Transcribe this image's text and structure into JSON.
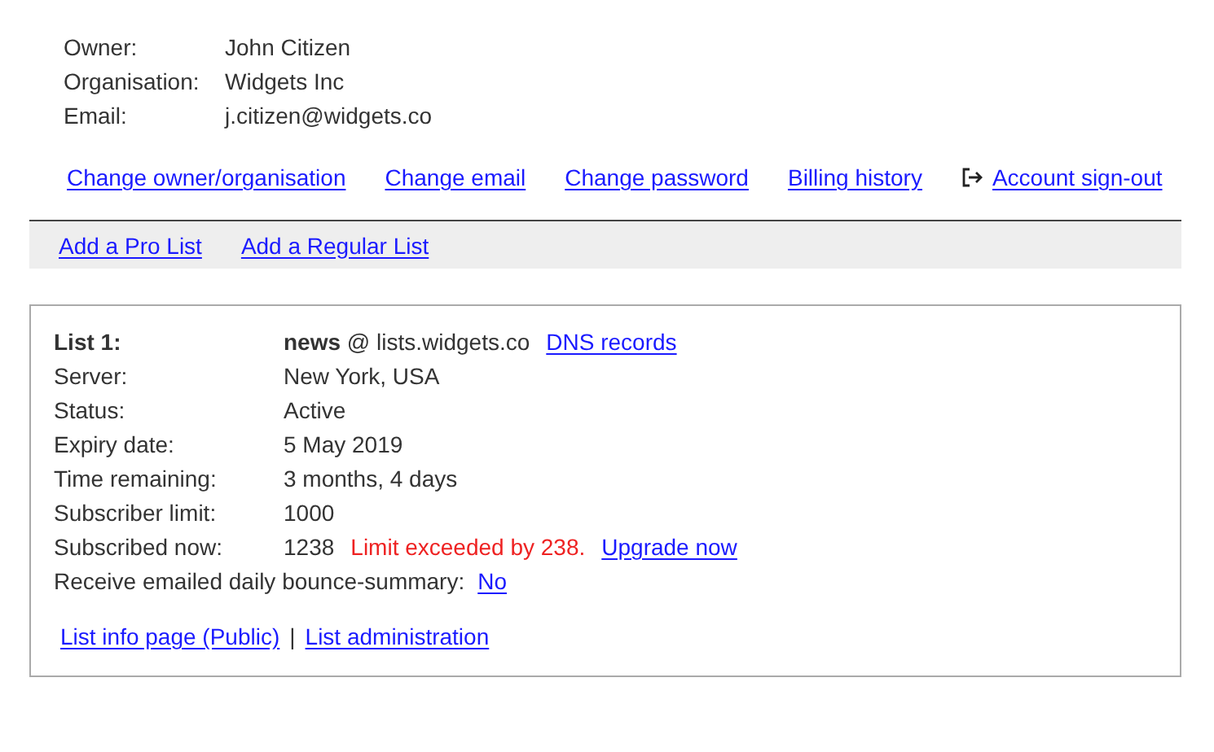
{
  "account": {
    "fields": [
      {
        "label": "Owner:",
        "value": "John Citizen"
      },
      {
        "label": "Organisation:",
        "value": "Widgets Inc"
      },
      {
        "label": "Email:",
        "value": "j.citizen@widgets.co"
      }
    ],
    "links": [
      {
        "label": "Change owner/organisation",
        "kind": "plain"
      },
      {
        "label": "Change email",
        "kind": "plain"
      },
      {
        "label": "Change password",
        "kind": "plain"
      },
      {
        "label": "Billing history",
        "kind": "plain"
      },
      {
        "label": "Account sign-out",
        "kind": "signout"
      }
    ]
  },
  "list_actions": [
    "Add a Pro List",
    "Add a Regular List"
  ],
  "list": {
    "label": "List 1:",
    "name": "news",
    "domain": "@ lists.widgets.co",
    "dns_link": "DNS records",
    "rows": [
      {
        "label": "Server:",
        "value": "New York, USA"
      },
      {
        "label": "Status:",
        "value": "Active"
      },
      {
        "label": "Expiry date:",
        "value": "5 May 2019"
      },
      {
        "label": "Time remaining:",
        "value": "3 months, 4 days"
      },
      {
        "label": "Subscriber limit:",
        "value": "1000"
      },
      {
        "label": "Subscribed now:",
        "value": "1238",
        "warning": "Limit exceeded by 238.",
        "link": "Upgrade now"
      }
    ],
    "bounce": {
      "label": "Receive emailed daily bounce-summary:",
      "link": "No"
    },
    "footer_links": [
      "List info page (Public)",
      "List administration"
    ],
    "footer_separator": "|"
  }
}
